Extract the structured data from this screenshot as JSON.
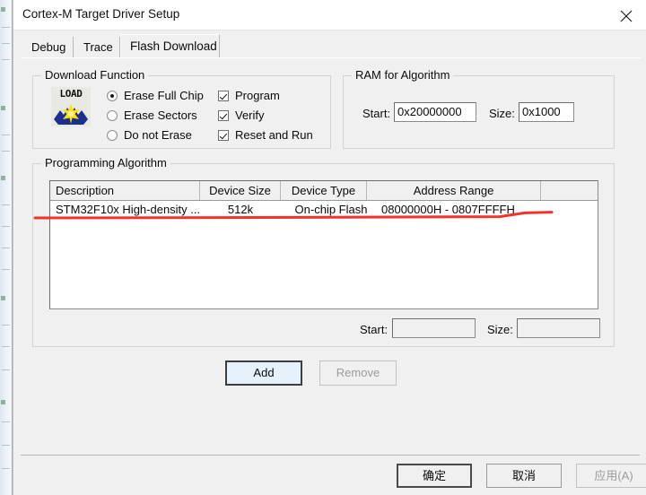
{
  "window": {
    "title": "Cortex-M Target Driver Setup",
    "close_icon": "close-icon"
  },
  "tabs": [
    {
      "label": "Debug",
      "active": false
    },
    {
      "label": "Trace",
      "active": false
    },
    {
      "label": "Flash Download",
      "active": true
    }
  ],
  "download_function": {
    "legend": "Download Function",
    "icon_text": "LOAD",
    "erase_options": [
      {
        "label": "Erase Full Chip",
        "selected": true
      },
      {
        "label": "Erase Sectors",
        "selected": false
      },
      {
        "label": "Do not Erase",
        "selected": false
      }
    ],
    "checkboxes": [
      {
        "label": "Program",
        "checked": true
      },
      {
        "label": "Verify",
        "checked": true
      },
      {
        "label": "Reset and Run",
        "checked": true
      }
    ]
  },
  "ram_for_algorithm": {
    "legend": "RAM for Algorithm",
    "start_label": "Start:",
    "start_value": "0x20000000",
    "size_label": "Size:",
    "size_value": "0x1000"
  },
  "programming_algorithm": {
    "legend": "Programming Algorithm",
    "columns": [
      "Description",
      "Device Size",
      "Device Type",
      "Address Range",
      ""
    ],
    "rows": [
      {
        "description": "STM32F10x High-density ...",
        "device_size": "512k",
        "device_type": "On-chip Flash",
        "address_range": "08000000H - 0807FFFFH"
      }
    ],
    "start_label": "Start:",
    "start_value": "",
    "size_label": "Size:",
    "size_value": "",
    "add_label": "Add",
    "remove_label": "Remove"
  },
  "footer": {
    "ok_label": "确定",
    "cancel_label": "取消",
    "apply_label": "应用(A)"
  },
  "annotation": {
    "color": "#f4322c",
    "description": "red-underline"
  }
}
